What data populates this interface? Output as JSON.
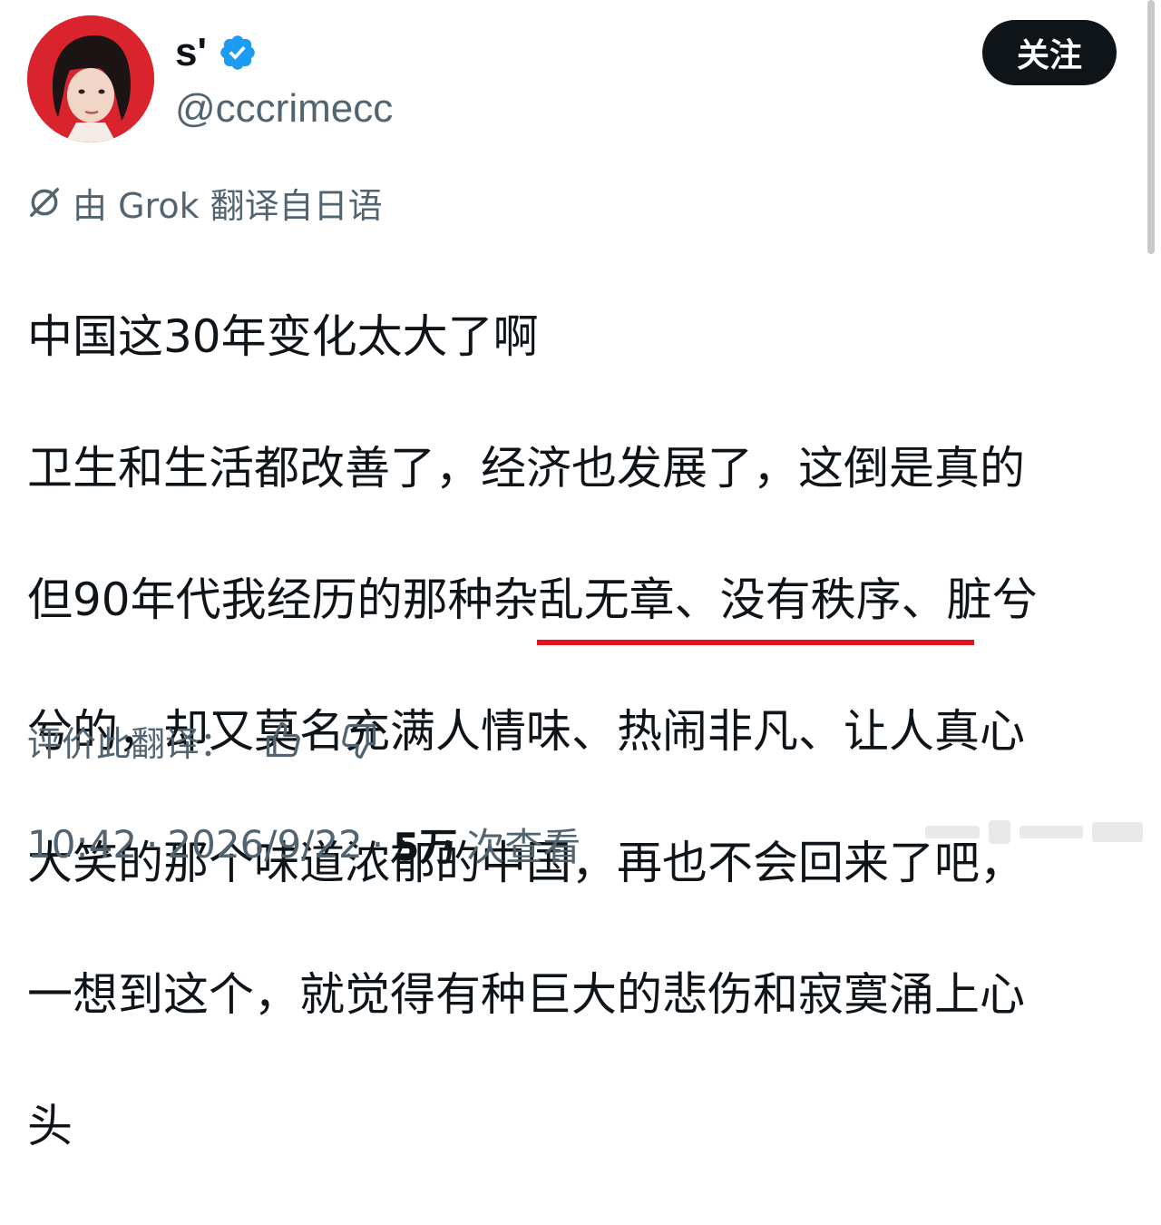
{
  "author": {
    "display_name": "s'",
    "handle": "@cccrimecc",
    "verified": true,
    "avatar_bg_color": "#d9232d"
  },
  "follow_button": {
    "label": "关注"
  },
  "translation": {
    "label": "由 Grok 翻译自日语",
    "icon": "grok-icon"
  },
  "tweet": {
    "lines": [
      "中国这30年变化太大了啊",
      "卫生和生活都改善了，经济也发展了，这倒是真的",
      "但90年代我经历的那种杂乱无章、没有秩序、脏兮",
      "兮的，却又莫名充满人情味、热闹非凡、让人真心",
      "大笑的那个味道浓郁的中国，再也不会回来了吧，",
      "一想到这个，就觉得有种巨大的悲伤和寂寞涌上心",
      "头"
    ],
    "highlight_color": "#e5141c"
  },
  "rate_translation": {
    "label": "评价此翻译：",
    "thumbs_up_icon": "thumbs-up-icon",
    "thumbs_down_icon": "thumbs-down-icon"
  },
  "meta": {
    "time": "10:42",
    "separator": "·",
    "date": "2026/9/22",
    "views_count": "5万",
    "views_label": "次查看"
  },
  "colors": {
    "text_primary": "#0f1419",
    "text_secondary": "#536471",
    "verified_blue": "#1d9bf0",
    "button_bg": "#0f1419"
  }
}
